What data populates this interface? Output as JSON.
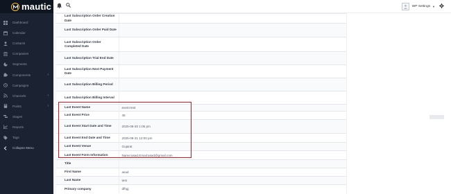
{
  "app": {
    "logo_text": "mautic"
  },
  "sidebar": {
    "items": [
      {
        "label": "Dashboard",
        "icon": "grid-icon"
      },
      {
        "label": "Calendar",
        "icon": "calendar-icon"
      },
      {
        "label": "Contacts",
        "icon": "user-icon"
      },
      {
        "label": "Companies",
        "icon": "building-icon"
      },
      {
        "label": "Segments",
        "icon": "pie-icon"
      },
      {
        "label": "Components",
        "icon": "puzzle-icon",
        "has_caret": true
      },
      {
        "label": "Campaigns",
        "icon": "clock-icon"
      },
      {
        "label": "Channels",
        "icon": "rss-icon",
        "has_caret": true
      },
      {
        "label": "Points",
        "icon": "calculator-icon",
        "has_caret": true
      },
      {
        "label": "Stages",
        "icon": "stages-icon"
      },
      {
        "label": "Reports",
        "icon": "chart-icon"
      },
      {
        "label": "Tags",
        "icon": "tag-icon"
      },
      {
        "label": "Collapse Menu",
        "icon": "collapse-arrow-icon"
      }
    ]
  },
  "topbar": {
    "user_name": "WP Settings"
  },
  "right": {
    "ghost_button": ""
  },
  "fields": [
    {
      "label": "Last Subscription Order Creation Date",
      "value": ""
    },
    {
      "label": "Last Subscription Order Paid Date",
      "value": ""
    },
    {
      "label": "Last Subscription Order Completed Date",
      "value": ""
    },
    {
      "label": "Last Subscription Trial End Date",
      "value": ""
    },
    {
      "label": "Last Subscription Next Payment Date",
      "value": ""
    },
    {
      "label": "Last Subscription Billing Period",
      "value": ""
    },
    {
      "label": "Last Subscription Billing Interval",
      "value": ""
    },
    {
      "label": "Last Event Name",
      "value": "event test"
    },
    {
      "label": "Last Event Price",
      "value": "45"
    },
    {
      "label": "Last Event Start Date and Time",
      "value": "2025-08-30 1:05 pm"
    },
    {
      "label": "Last Event End Date and Time",
      "value": "2025-08-31 12:00 pm"
    },
    {
      "label": "Last Event Venue",
      "value": "Gujarat"
    },
    {
      "label": "Last Event Form Information",
      "value": "Name:asad,Email:asad@gmail.com"
    },
    {
      "label": "Title",
      "value": ""
    },
    {
      "label": "First Name",
      "value": "asad"
    },
    {
      "label": "Last Name",
      "value": "test"
    },
    {
      "label": "Primary company",
      "value": "dfhgj"
    }
  ],
  "colors": {
    "sidebar_bg": "#1b2333",
    "highlight": "#d0141c",
    "logo_accent": "#fdb933"
  }
}
